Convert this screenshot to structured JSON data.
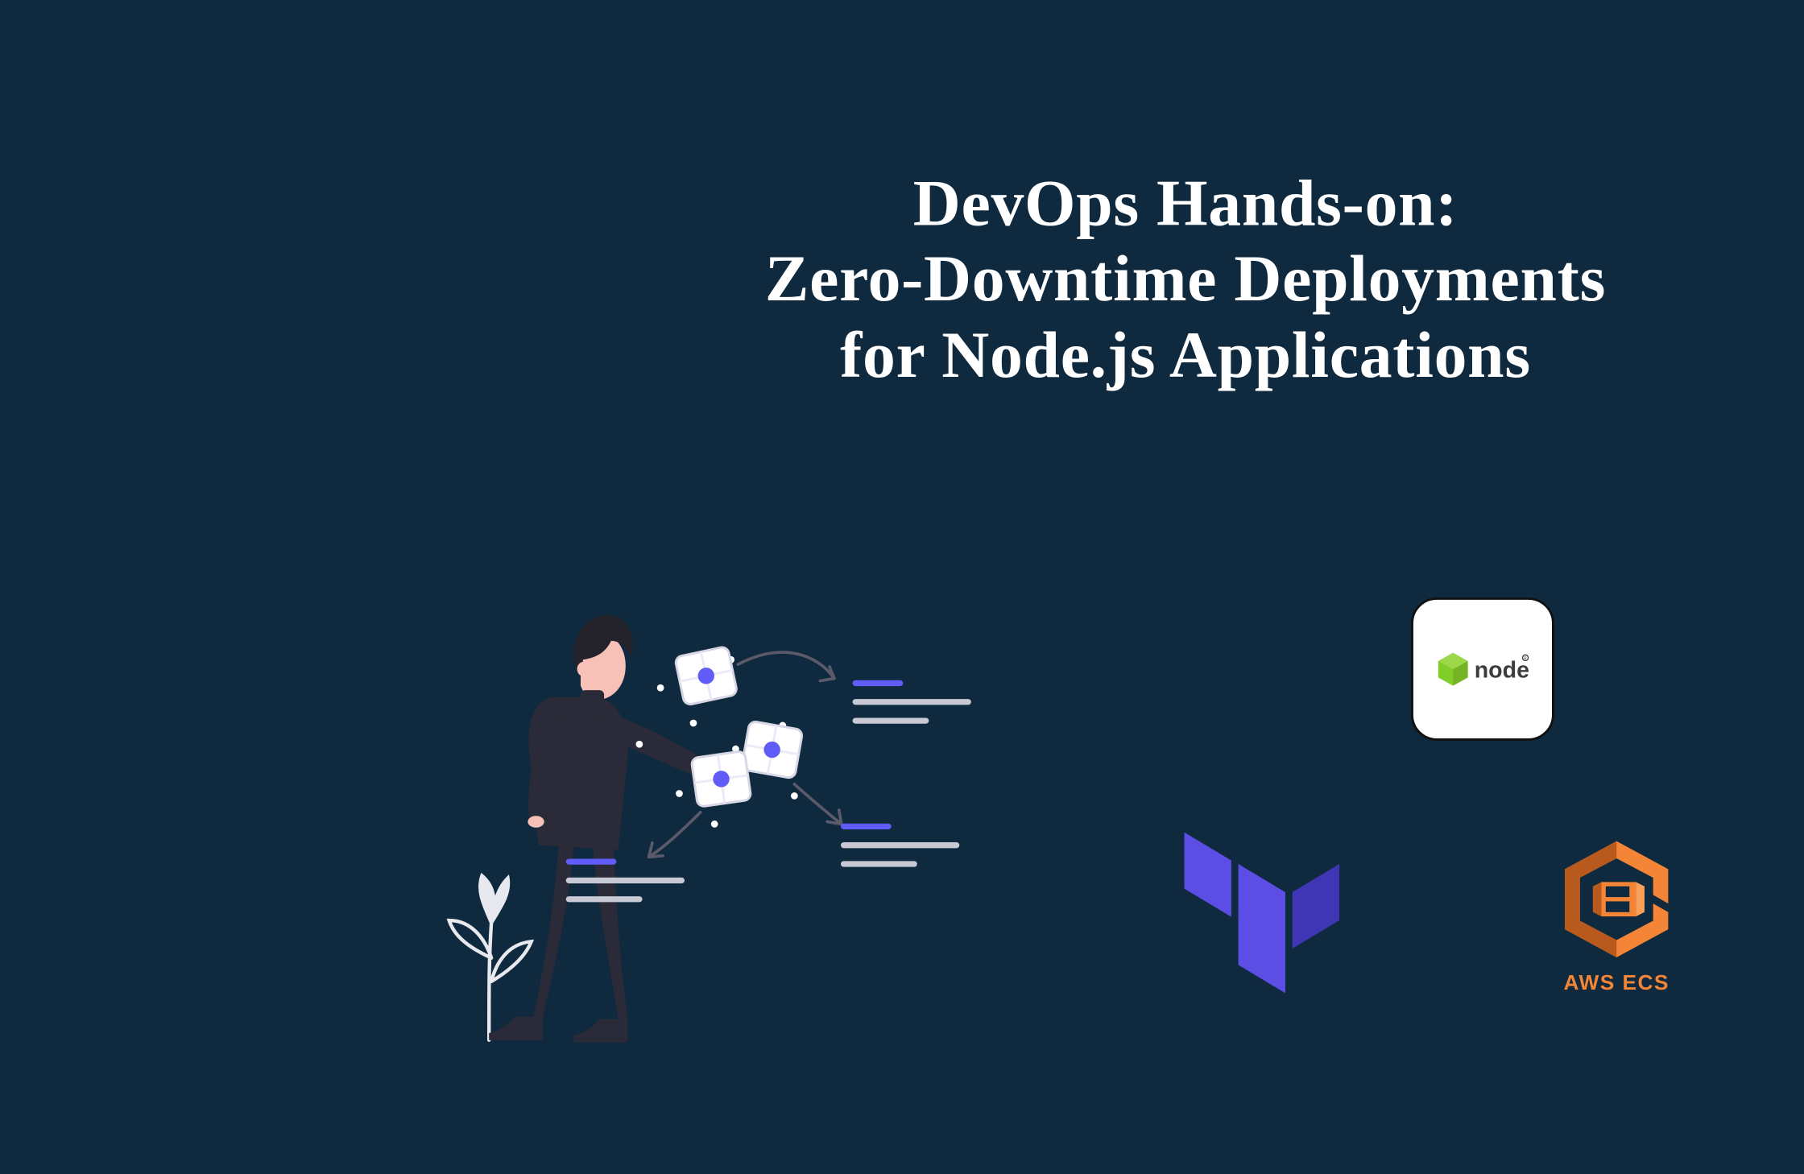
{
  "title": {
    "line1": "DevOps Hands-on:",
    "line2": "Zero-Downtime Deployments",
    "line3": "for Node.js Applications"
  },
  "logos": {
    "node_text": "node",
    "ecs_label": "AWS ECS"
  },
  "colors": {
    "bg": "#0f2a3e",
    "white": "#ffffff",
    "accent": "#615cf7",
    "terraform": "#5c4ee5",
    "terraform_dark": "#3f36b5",
    "ecs_orange": "#f58536",
    "ecs_dark": "#b85a1e",
    "node_green": "#83cd29",
    "skin": "#f7c1b8",
    "dark_body": "#2a2a38",
    "hair": "#24232c"
  }
}
